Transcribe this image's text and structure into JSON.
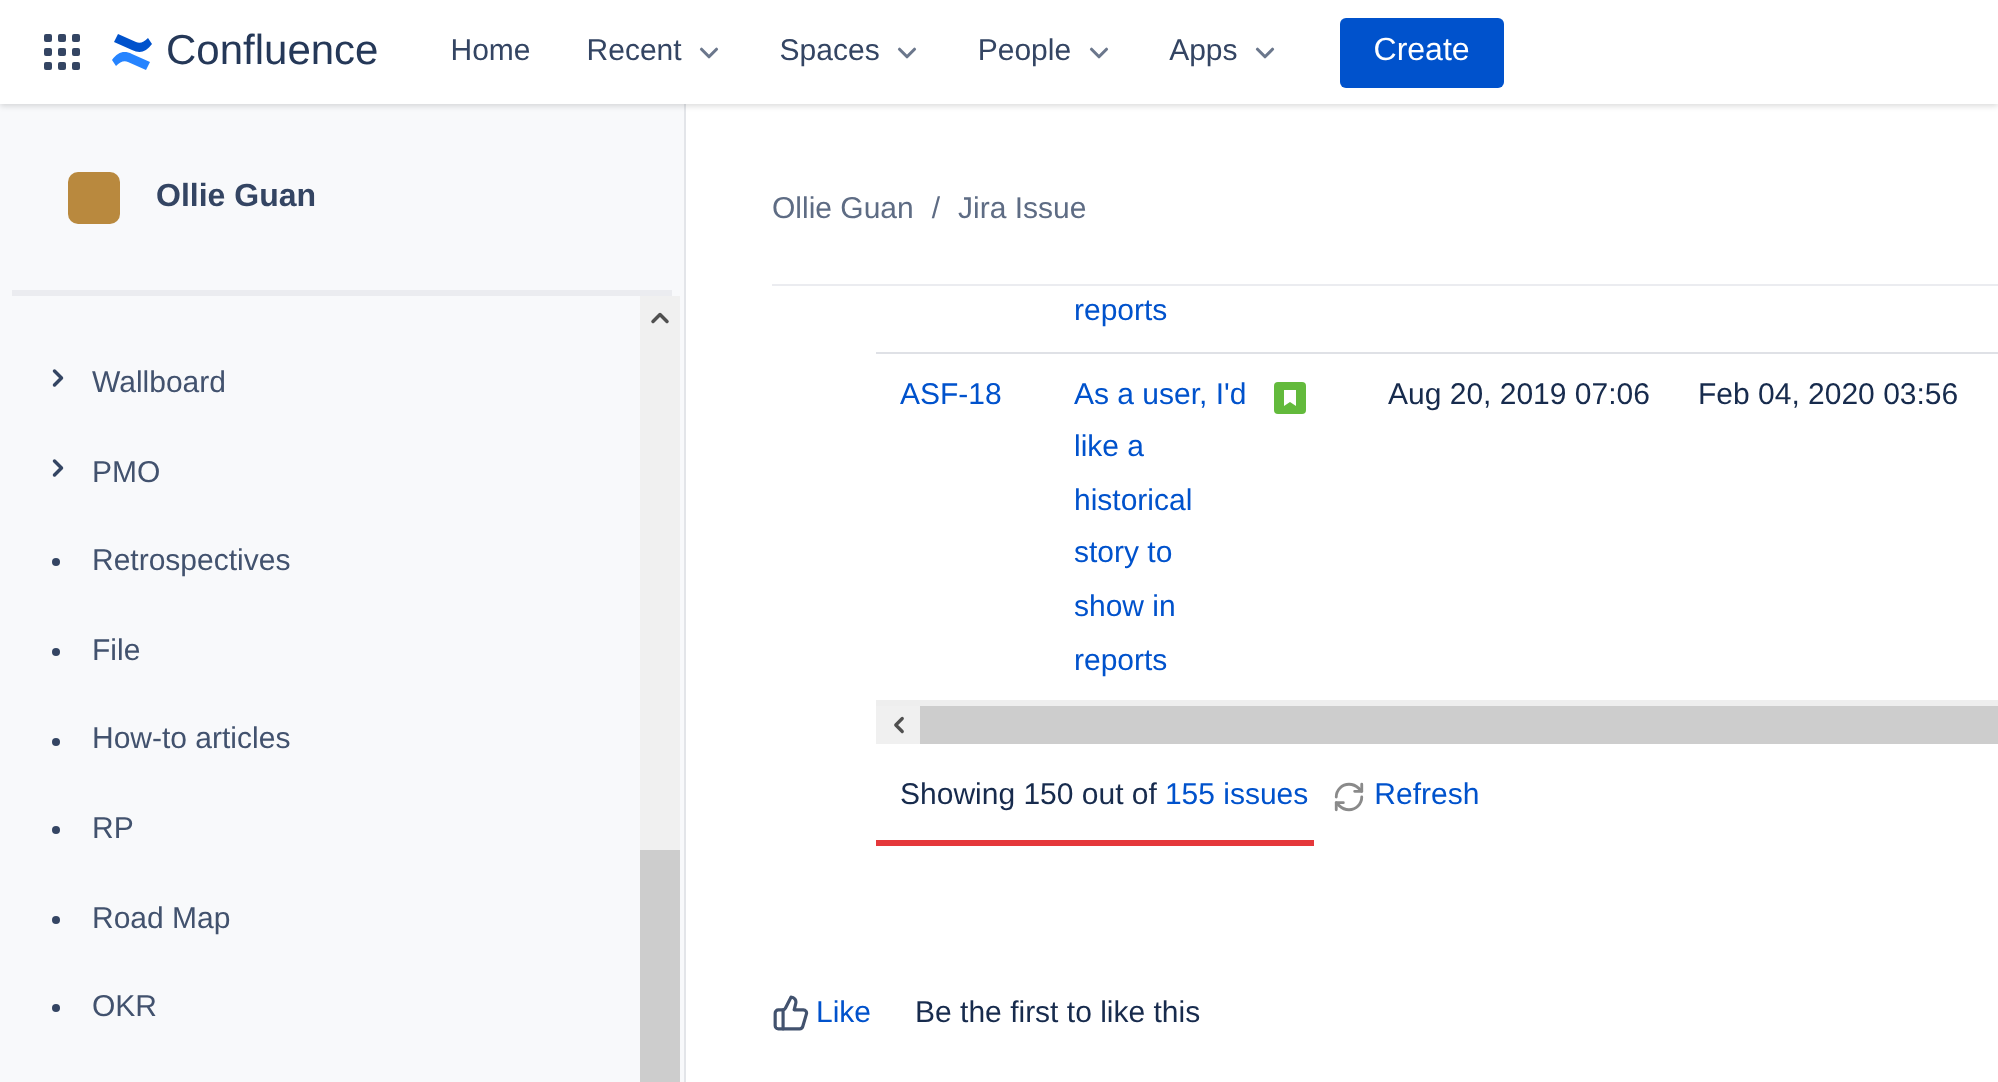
{
  "top_nav": {
    "product": "Confluence",
    "items": [
      {
        "label": "Home",
        "dropdown": false
      },
      {
        "label": "Recent",
        "dropdown": true
      },
      {
        "label": "Spaces",
        "dropdown": true
      },
      {
        "label": "People",
        "dropdown": true
      },
      {
        "label": "Apps",
        "dropdown": true
      }
    ],
    "create_button": "Create"
  },
  "sidebar": {
    "space_name": "Ollie Guan",
    "items": [
      {
        "label": "Wallboard",
        "kind": "expandable"
      },
      {
        "label": "PMO",
        "kind": "expandable"
      },
      {
        "label": "Retrospectives",
        "kind": "page"
      },
      {
        "label": "File",
        "kind": "page"
      },
      {
        "label": "How-to articles",
        "kind": "page"
      },
      {
        "label": "RP",
        "kind": "page"
      },
      {
        "label": "Road Map",
        "kind": "page"
      },
      {
        "label": "OKR",
        "kind": "page"
      }
    ]
  },
  "breadcrumb": {
    "items": [
      "Ollie Guan",
      "Jira Issue"
    ],
    "separator": "/"
  },
  "table": {
    "rows": [
      {
        "key": "",
        "summary": "reports",
        "kind": "partial",
        "created": "",
        "updated": ""
      },
      {
        "key": "ASF-18",
        "summary": "As a user, I'd like a historical story to show in reports",
        "kind": "story",
        "created": "Aug 20, 2019 07:06",
        "updated": "Feb 04, 2020 03:56"
      }
    ]
  },
  "footer": {
    "showing": "Showing 150 out of",
    "issues_link": "155 issues",
    "refresh": "Refresh"
  },
  "likes": {
    "like_button": "Like",
    "text": "Be the first to like this"
  }
}
